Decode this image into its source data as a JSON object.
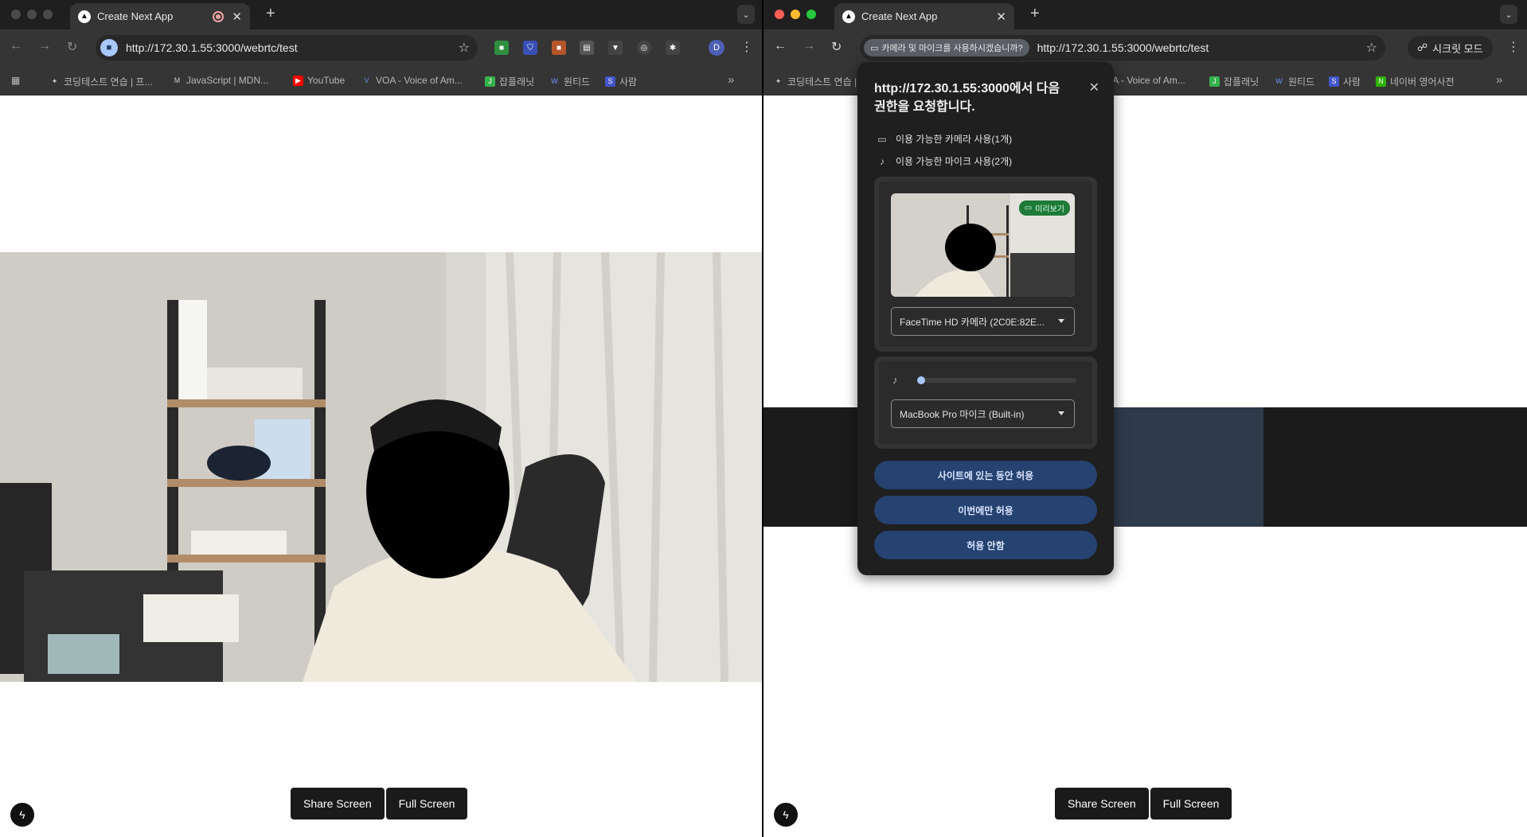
{
  "left_window": {
    "tab_title": "Create Next App",
    "new_tab_symbol": "+",
    "url": "http://172.30.1.55:3000/webrtc/test",
    "profile_initial": "D",
    "bookmarks": [
      {
        "label": "코딩테스트 연습 | 프...",
        "icon": "sparkle-icon",
        "color": "#cccccc"
      },
      {
        "label": "JavaScript | MDN...",
        "icon": "mdn-icon",
        "color": "#cccccc"
      },
      {
        "label": "YouTube",
        "icon": "youtube-icon",
        "color": "#ff0000"
      },
      {
        "label": "VOA - Voice of Am...",
        "icon": "voa-icon",
        "color": "#3b5fb4"
      },
      {
        "label": "잡플래닛",
        "icon": "jobplanet-icon",
        "color": "#36b24b"
      },
      {
        "label": "원티드",
        "icon": "wanted-icon",
        "color": "#3366ff"
      },
      {
        "label": "사람",
        "icon": "saramin-icon",
        "color": "#4255c9"
      }
    ],
    "buttons": {
      "share": "Share Screen",
      "full": "Full Screen"
    }
  },
  "right_window": {
    "tab_title": "Create Next App",
    "new_tab_symbol": "+",
    "permission_chip": "카메라 및 마이크를 사용하시겠습니까?",
    "url": "http://172.30.1.55:3000/webrtc/test",
    "incognito_label": "시크릿 모드",
    "bookmarks": [
      {
        "label": "코딩테스트 연습 |",
        "icon": "sparkle-icon",
        "color": "#cccccc"
      },
      {
        "label": "OA - Voice of Am...",
        "icon": "voa-icon",
        "color": "#3b5fb4"
      },
      {
        "label": "잡플래닛",
        "icon": "jobplanet-icon",
        "color": "#36b24b"
      },
      {
        "label": "원티드",
        "icon": "wanted-icon",
        "color": "#3366ff"
      },
      {
        "label": "사람",
        "icon": "saramin-icon",
        "color": "#4255c9"
      },
      {
        "label": "네이버 영어사전",
        "icon": "naver-icon",
        "color": "#2db400"
      }
    ],
    "buttons": {
      "share": "Share Screen",
      "full": "Full Screen"
    }
  },
  "permission_popup": {
    "title": "http://172.30.1.55:3000에서 다음 권한을 요청합니다.",
    "camera_permission": "이용 가능한 카메라 사용(1개)",
    "mic_permission": "이용 가능한 마이크 사용(2개)",
    "preview_badge": "미리보기",
    "camera_select": "FaceTime HD 카메라 (2C0E:82E...",
    "mic_select": "MacBook Pro 마이크 (Built-in)",
    "mic_level": 0.0,
    "allow_while_visiting": "사이트에 있는 동안 허용",
    "allow_this_time": "이번에만 허용",
    "deny": "허용 안함"
  },
  "colors": {
    "popup_button": "#254270",
    "accent": "#a8c7fa",
    "preview_badge": "#1e7a38"
  }
}
